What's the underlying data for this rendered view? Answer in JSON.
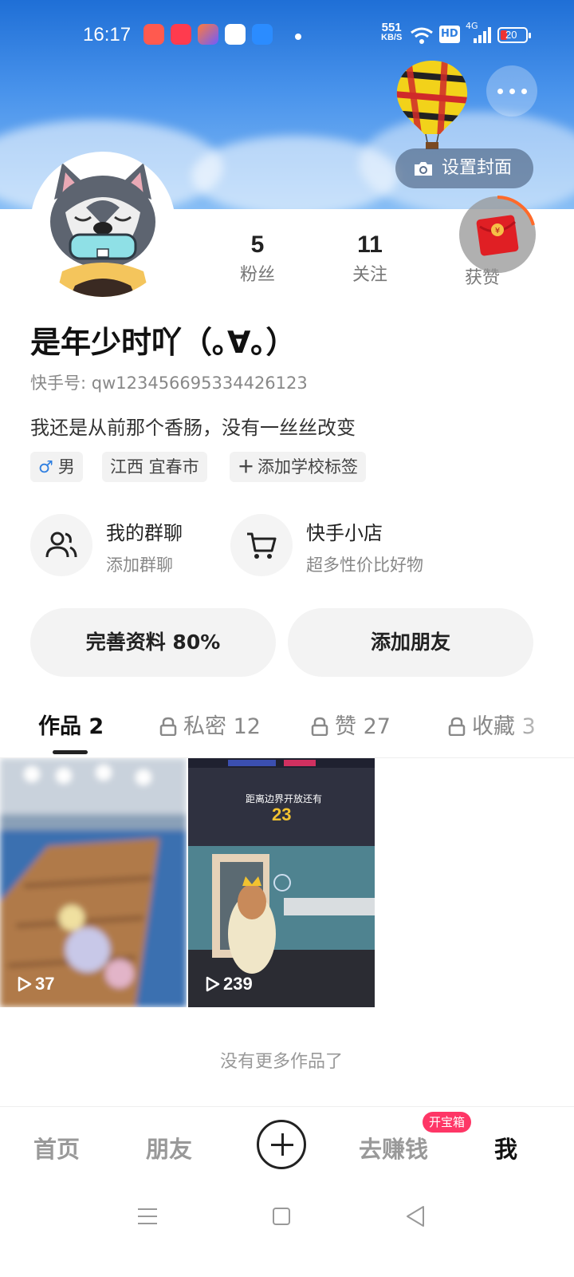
{
  "status_bar": {
    "time": "16:17",
    "net_speed_value": "551",
    "net_speed_unit": "KB/S",
    "hd_label": "HD",
    "network_label": "4G",
    "battery_level": "20"
  },
  "header": {
    "set_cover_label": "设置封面"
  },
  "stats": [
    {
      "value": "5",
      "label": "粉丝"
    },
    {
      "value": "11",
      "label": "关注"
    },
    {
      "value": "",
      "label": "获赞"
    }
  ],
  "profile": {
    "name": "是年少时吖（｡∀｡）",
    "kuaishou_id": "快手号: qw123456695334426123",
    "bio": "我还是从前那个香肠，没有一丝丝改变",
    "tags": {
      "gender": "男",
      "location": "江西 宜春市",
      "add_school": "添加学校标签"
    }
  },
  "entries": [
    {
      "title": "我的群聊",
      "subtitle": "添加群聊"
    },
    {
      "title": "快手小店",
      "subtitle": "超多性价比好物"
    }
  ],
  "buttons": {
    "complete_profile": "完善资料 80%",
    "add_friend": "添加朋友"
  },
  "tabs": [
    {
      "label": "作品 2"
    },
    {
      "label": "私密 12"
    },
    {
      "label": "赞 27"
    },
    {
      "label": "收藏 3"
    }
  ],
  "videos": [
    {
      "plays": "37"
    },
    {
      "plays": "239"
    }
  ],
  "video2_overlay": {
    "title": "距离边界开放还有",
    "countdown": "23"
  },
  "no_more_text": "没有更多作品了",
  "bottom_nav": {
    "home": "首页",
    "friends": "朋友",
    "earn": "去赚钱",
    "earn_badge": "开宝箱",
    "me": "我"
  },
  "colors": {
    "cover_blue": "#2f7fe0",
    "badge_red": "#fe3666",
    "gender_blue": "#2f7fe0"
  }
}
